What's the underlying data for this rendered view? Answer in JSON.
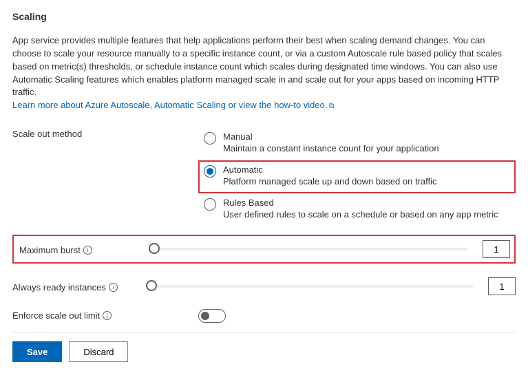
{
  "title": "Scaling",
  "description": "App service provides multiple features that help applications perform their best when scaling demand changes. You can choose to scale your resource manually to a specific instance count, or via a custom Autoscale rule based policy that scales based on metric(s) thresholds, or schedule instance count which scales during designated time windows. You can also use Automatic Scaling features which enables platform managed scale in and scale out for your apps based on incoming HTTP traffic.",
  "learn_more_link": "Learn more about Azure Autoscale, Automatic Scaling or view the how-to video.",
  "fields": {
    "scale_out_method": {
      "label": "Scale out method",
      "selected": "automatic",
      "options": {
        "manual": {
          "label": "Manual",
          "description": "Maintain a constant instance count for your application"
        },
        "automatic": {
          "label": "Automatic",
          "description": "Platform managed scale up and down based on traffic"
        },
        "rules": {
          "label": "Rules Based",
          "description": "User defined rules to scale on a schedule or based on any app metric"
        }
      }
    },
    "maximum_burst": {
      "label": "Maximum burst",
      "value": "1"
    },
    "always_ready": {
      "label": "Always ready instances",
      "value": "1"
    },
    "enforce_limit": {
      "label": "Enforce scale out limit",
      "value": false
    }
  },
  "buttons": {
    "save": "Save",
    "discard": "Discard"
  }
}
